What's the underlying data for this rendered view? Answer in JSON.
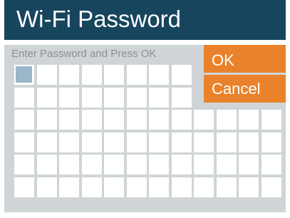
{
  "title": "Wi-Fi Password",
  "prompt": "Enter Password and Press OK",
  "buttons": {
    "ok": "OK",
    "cancel": "Cancel"
  },
  "password_grid": {
    "rows": 6,
    "columns": 12,
    "filled_characters": 0,
    "cursor_position": 1
  },
  "colors": {
    "title_bar": "#18455e",
    "panel": "#cfd5d7",
    "button": "#e9822b",
    "cursor": "#9ab6c9",
    "prompt_text": "#8b8f92"
  }
}
